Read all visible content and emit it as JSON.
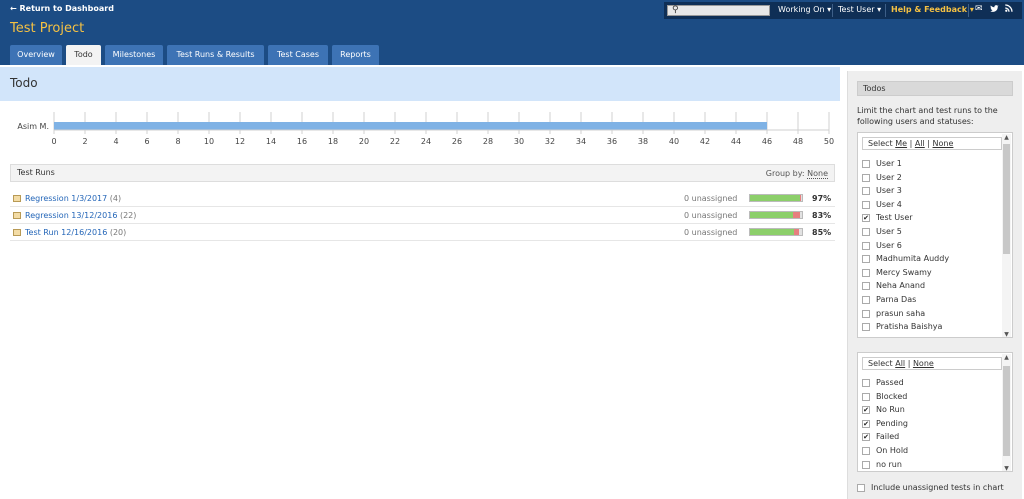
{
  "header": {
    "return_link": "← Return to Dashboard",
    "project_title": "Test Project",
    "search_placeholder": "",
    "working_on": "Working On ▾",
    "user_menu": "Test User ▾",
    "help_menu": "Help & Feedback ▾",
    "icons": [
      "mail-icon",
      "twitter-icon",
      "rss-icon"
    ]
  },
  "tabs": [
    {
      "label": "Overview",
      "active": false
    },
    {
      "label": "Todo",
      "active": true
    },
    {
      "label": "Milestones",
      "active": false
    },
    {
      "label": "Test Runs & Results",
      "active": false
    },
    {
      "label": "Test Cases",
      "active": false
    },
    {
      "label": "Reports",
      "active": false
    }
  ],
  "main": {
    "title": "Todo"
  },
  "chart_data": {
    "type": "bar",
    "orientation": "horizontal",
    "categories": [
      "Asim M."
    ],
    "values": [
      46
    ],
    "xlim": [
      0,
      50
    ],
    "xticks": [
      0,
      2,
      4,
      6,
      8,
      10,
      12,
      14,
      16,
      18,
      20,
      22,
      24,
      26,
      28,
      30,
      32,
      34,
      36,
      38,
      40,
      42,
      44,
      46,
      48,
      50
    ],
    "bar_color": "#7fb2e5",
    "grid": true
  },
  "test_runs": {
    "title": "Test Runs",
    "group_by_label": "Group by:",
    "group_by_value": "None",
    "rows": [
      {
        "name": "Regression 1/3/2017",
        "count": "(4)",
        "unassigned": "0 unassigned",
        "percent": "97%",
        "bar": {
          "passed": 0.96,
          "failed": 0.02,
          "other": 0.02
        }
      },
      {
        "name": "Regression 13/12/2016",
        "count": "(22)",
        "unassigned": "0 unassigned",
        "percent": "83%",
        "bar": {
          "passed": 0.82,
          "failed": 0.14,
          "other": 0.04
        }
      },
      {
        "name": "Test Run 12/16/2016",
        "count": "(20)",
        "unassigned": "0 unassigned",
        "percent": "85%",
        "bar": {
          "passed": 0.84,
          "failed": 0.1,
          "other": 0.06
        }
      }
    ]
  },
  "sidebar": {
    "title": "Todos",
    "description": "Limit the chart and test runs to the following users and statuses:",
    "users_select_prefix": "Select",
    "users_select_me": "Me",
    "users_select_all": "All",
    "users_select_none": "None",
    "users": [
      {
        "label": "User 1",
        "checked": false
      },
      {
        "label": "User 2",
        "checked": false
      },
      {
        "label": "User 3",
        "checked": false
      },
      {
        "label": "User 4",
        "checked": false
      },
      {
        "label": "Test User",
        "checked": true
      },
      {
        "label": "User 5",
        "checked": false
      },
      {
        "label": "User 6",
        "checked": false
      },
      {
        "label": "Madhumita Auddy",
        "checked": false
      },
      {
        "label": "Mercy Swamy",
        "checked": false
      },
      {
        "label": "Neha Anand",
        "checked": false
      },
      {
        "label": "Parna Das",
        "checked": false
      },
      {
        "label": "prasun saha",
        "checked": false
      },
      {
        "label": "Pratisha Baishya",
        "checked": false
      }
    ],
    "status_select_prefix": "Select",
    "status_select_all": "All",
    "status_select_none": "None",
    "statuses": [
      {
        "label": "Passed",
        "checked": false
      },
      {
        "label": "Blocked",
        "checked": false
      },
      {
        "label": "No Run",
        "checked": true
      },
      {
        "label": "Pending",
        "checked": true
      },
      {
        "label": "Failed",
        "checked": true
      },
      {
        "label": "On Hold",
        "checked": false
      },
      {
        "label": "no run",
        "checked": false
      }
    ],
    "include_unassigned_label": "Include unassigned tests in chart",
    "include_unassigned_checked": false
  },
  "colors": {
    "header_bg": "#1c4c84",
    "accent": "#f5c143",
    "tab_bg": "#3d73b5",
    "title_band": "#d2e5fa",
    "passed": "#8ccf6a",
    "failed": "#e77f7f",
    "other": "#e2e2e2"
  }
}
